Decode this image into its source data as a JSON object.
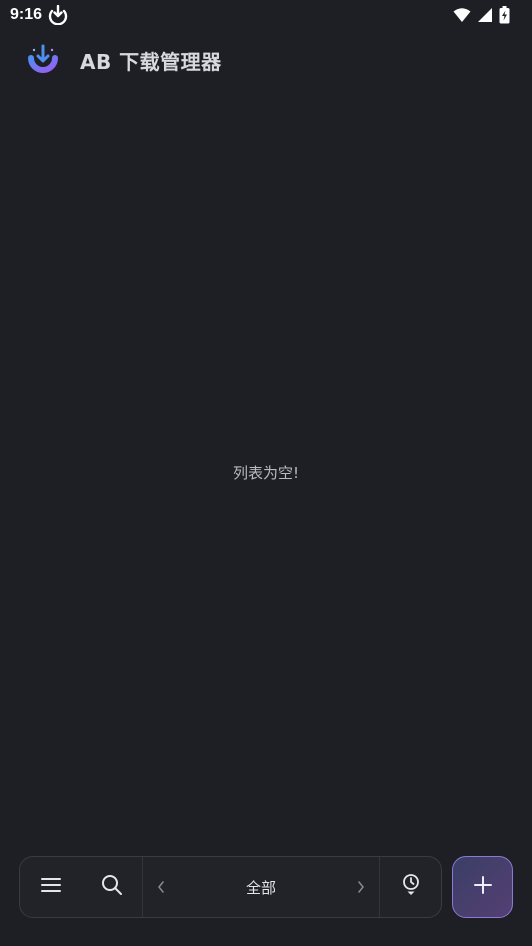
{
  "status_bar": {
    "time": "9:16",
    "icons": [
      "download-notification-icon",
      "wifi-icon",
      "signal-icon",
      "battery-icon"
    ]
  },
  "app_bar": {
    "title": "AB 下载管理器",
    "logo_icon": "app-logo-icon"
  },
  "main": {
    "empty_message": "列表为空!"
  },
  "bottom_bar": {
    "menu_icon": "menu-icon",
    "search_icon": "search-icon",
    "prev_icon": "chevron-left-icon",
    "category_label": "全部",
    "next_icon": "chevron-right-icon",
    "queue_icon": "clock-download-icon"
  },
  "fab": {
    "icon": "plus-icon"
  },
  "colors": {
    "background": "#1e1f24",
    "accent": "#8d78d6",
    "logo_blue": "#4f8ef2",
    "logo_purple": "#9a5cf2"
  }
}
